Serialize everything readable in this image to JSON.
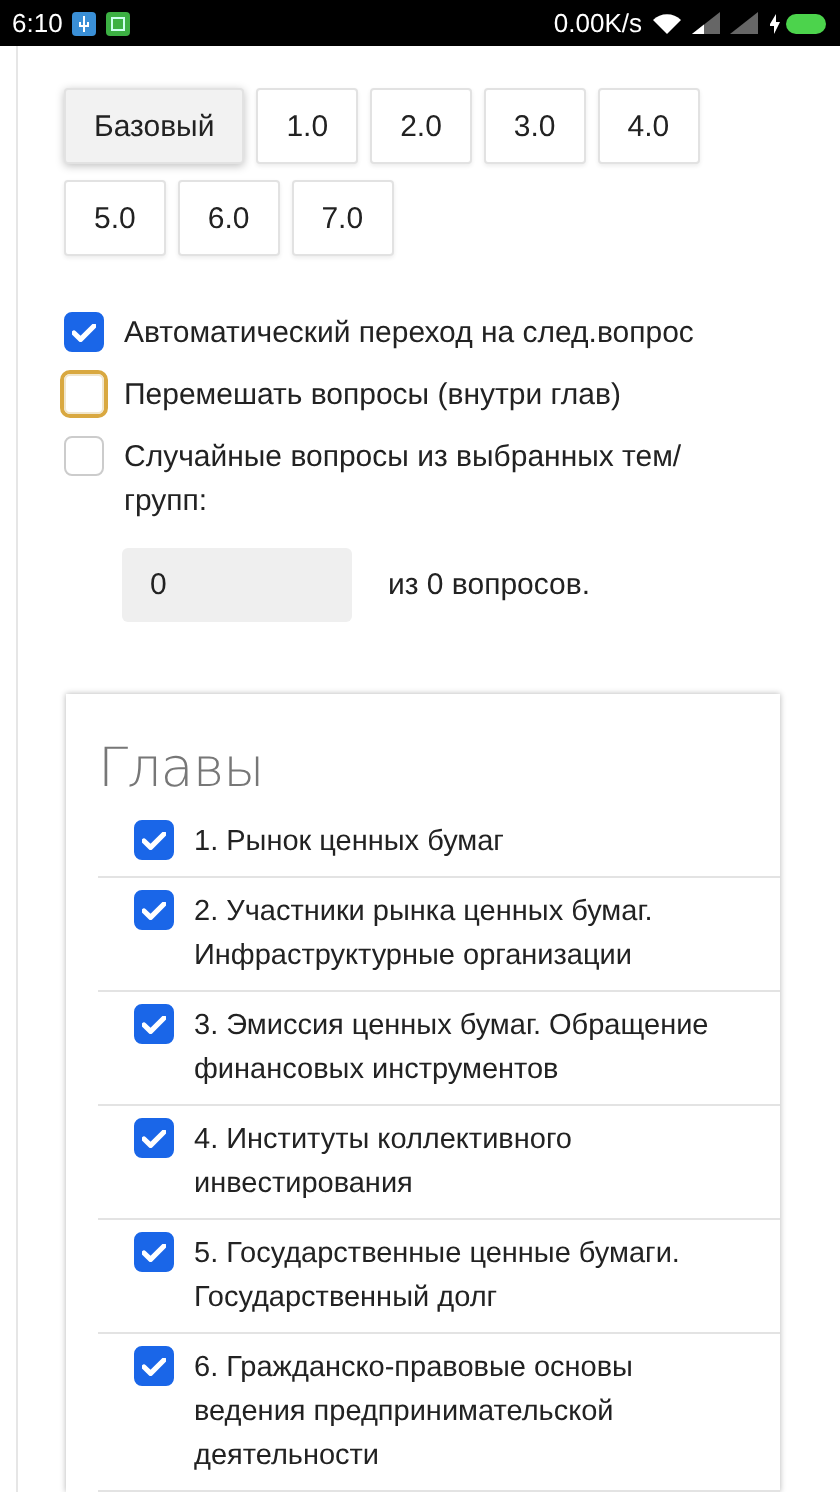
{
  "status_bar": {
    "time": "6:10",
    "net_speed": "0.00K/s"
  },
  "versions": [
    {
      "label": "Базовый",
      "selected": true
    },
    {
      "label": "1.0",
      "selected": false
    },
    {
      "label": "2.0",
      "selected": false
    },
    {
      "label": "3.0",
      "selected": false
    },
    {
      "label": "4.0",
      "selected": false
    },
    {
      "label": "5.0",
      "selected": false
    },
    {
      "label": "6.0",
      "selected": false
    },
    {
      "label": "7.0",
      "selected": false
    }
  ],
  "options": [
    {
      "label": "Автоматический переход на след.вопрос",
      "checked": true,
      "focused": false
    },
    {
      "label": "Перемешать вопросы (внутри глав)",
      "checked": false,
      "focused": true
    },
    {
      "label": "Случайные вопросы из выбранных тем/групп:",
      "checked": false,
      "focused": false
    }
  ],
  "random_count": {
    "value": "0",
    "suffix": "из 0 вопросов."
  },
  "chapters_card": {
    "title": "Главы",
    "chapters": [
      {
        "label": "1. Рынок ценных бумаг",
        "checked": true
      },
      {
        "label": "2. Участники рынка ценных бумаг. Инфраструктурные организации",
        "checked": true
      },
      {
        "label": "3. Эмиссия ценных бумаг. Обращение финансовых инструментов",
        "checked": true
      },
      {
        "label": "4. Институты коллективного инвестирования",
        "checked": true
      },
      {
        "label": "5. Государственные ценные бумаги. Государственный долг",
        "checked": true
      },
      {
        "label": "6. Гражданско-правовые основы ведения предпринимательской деятельности",
        "checked": true
      }
    ]
  }
}
